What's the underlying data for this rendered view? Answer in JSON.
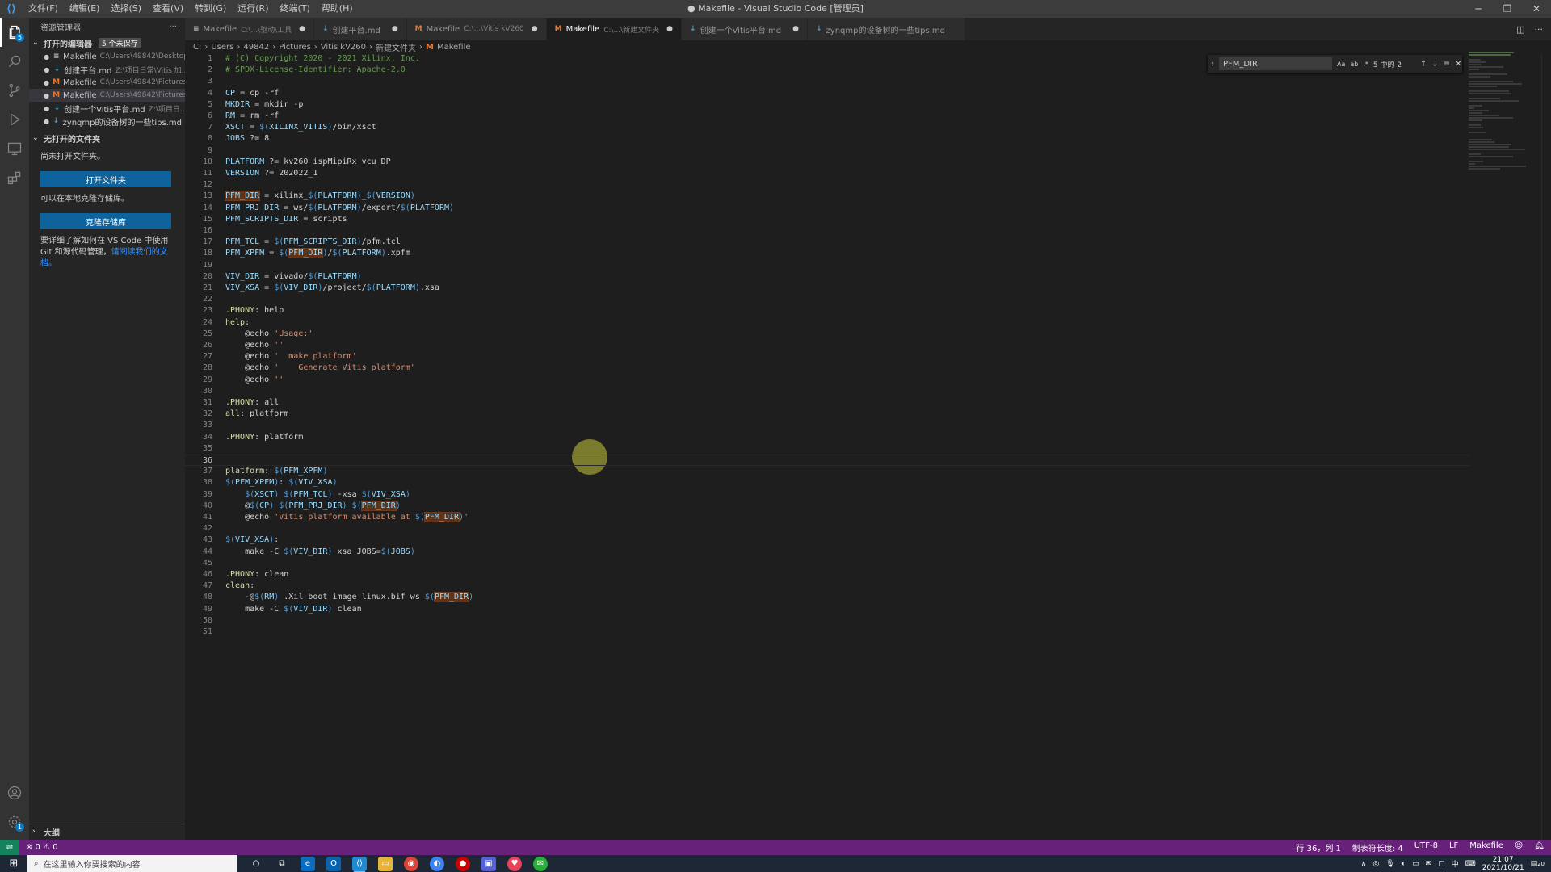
{
  "window": {
    "title": "● Makefile - Visual Studio Code [管理员]",
    "menu": [
      "文件(F)",
      "编辑(E)",
      "选择(S)",
      "查看(V)",
      "转到(G)",
      "运行(R)",
      "终端(T)",
      "帮助(H)"
    ]
  },
  "activity": {
    "icons": [
      "explorer-icon",
      "search-icon",
      "source-control-icon",
      "run-debug-icon",
      "remote-explorer-icon",
      "extensions-icon"
    ],
    "explorer_badge": "5",
    "settings_badge": "1"
  },
  "sidebar": {
    "header": "资源管理器",
    "more": "···",
    "open_editors_label": "打开的编辑器",
    "unsaved_badge": "5 个未保存",
    "open_editors": [
      {
        "icon": "≡",
        "icon_color": "#cccccc",
        "name": "Makefile",
        "path": "C:\\Users\\49842\\Desktop..."
      },
      {
        "icon": "↓",
        "icon_color": "#519aba",
        "name": "创建平台.md",
        "path": "Z:\\项目日常\\Vitis 加..."
      },
      {
        "icon": "M",
        "icon_color": "#e37933",
        "name": "Makefile",
        "path": "C:\\Users\\49842\\Pictures\\..."
      },
      {
        "icon": "M",
        "icon_color": "#e37933",
        "name": "Makefile",
        "path": "C:\\Users\\49842\\Pictures\\..."
      },
      {
        "icon": "↓",
        "icon_color": "#519aba",
        "name": "创建一个Vitis平台.md",
        "path": "Z:\\项目日..."
      },
      {
        "icon": "↓",
        "icon_color": "#519aba",
        "name": "zynqmp的设备树的一些tips.md",
        "path": ""
      }
    ],
    "no_folder_label": "无打开的文件夹",
    "no_folder_text": "尚未打开文件夹。",
    "open_folder_button": "打开文件夹",
    "clone_text": "可以在本地克隆存储库。",
    "clone_button": "克隆存储库",
    "git_text": "要详细了解如何在 VS Code 中使用 Git 和源代码管理，",
    "git_link": "请阅读我们的文档。",
    "outline_label": "大纲"
  },
  "tabs": [
    {
      "icon": "≡",
      "icon_color": "#cccccc",
      "name": "Makefile",
      "path": "C:\\...\\驱动\\工具",
      "dirty": "●",
      "active": false
    },
    {
      "icon": "↓",
      "icon_color": "#519aba",
      "name": "创建平台.md",
      "path": "",
      "dirty": "●",
      "active": false
    },
    {
      "icon": "M",
      "icon_color": "#e37933",
      "name": "Makefile",
      "path": "C:\\...\\Vitis kV260",
      "dirty": "●",
      "active": false
    },
    {
      "icon": "M",
      "icon_color": "#e37933",
      "name": "Makefile",
      "path": "C:\\...\\新建文件夹",
      "dirty": "●",
      "active": true
    },
    {
      "icon": "↓",
      "icon_color": "#519aba",
      "name": "创建一个Vitis平台.md",
      "path": "",
      "dirty": "●",
      "active": false
    },
    {
      "icon": "↓",
      "icon_color": "#519aba",
      "name": "zynqmp的设备树的一些tips.md",
      "path": "",
      "dirty": "",
      "active": false
    }
  ],
  "breadcrumb": [
    "C:",
    "Users",
    "49842",
    "Pictures",
    "Vitis kV260",
    "新建文件夹",
    "Makefile"
  ],
  "find": {
    "value": "PFM_DIR",
    "options": [
      "Aa",
      "ab",
      ".*"
    ],
    "count": "5 中的 2"
  },
  "editor": {
    "current_line": 36,
    "lines": [
      [
        [
          "c-comment",
          "# (C) Copyright 2020 - 2021 Xilinx, Inc."
        ]
      ],
      [
        [
          "c-comment",
          "# SPDX-License-Identifier: Apache-2.0"
        ]
      ],
      [],
      [
        [
          "c-var",
          "CP"
        ],
        [
          "",
          " = cp -rf"
        ]
      ],
      [
        [
          "c-var",
          "MKDIR"
        ],
        [
          "",
          " = mkdir -p"
        ]
      ],
      [
        [
          "c-var",
          "RM"
        ],
        [
          "",
          " = rm -rf"
        ]
      ],
      [
        [
          "c-var",
          "XSCT"
        ],
        [
          "",
          " = "
        ],
        [
          "c-mac",
          "$("
        ],
        [
          "c-var",
          "XILINX_VITIS"
        ],
        [
          "c-mac",
          ")"
        ],
        [
          "",
          "/bin/xsct"
        ]
      ],
      [
        [
          "c-var",
          "JOBS"
        ],
        [
          "",
          " ?= 8"
        ]
      ],
      [],
      [
        [
          "c-var",
          "PLATFORM"
        ],
        [
          "",
          " ?= kv260_ispMipiRx_vcu_DP"
        ]
      ],
      [
        [
          "c-var",
          "VERSION"
        ],
        [
          "",
          " ?= 202022_1"
        ]
      ],
      [],
      [
        [
          "c-var hl",
          "PFM_DIR"
        ],
        [
          "",
          " = xilinx_"
        ],
        [
          "c-mac",
          "$("
        ],
        [
          "c-var",
          "PLATFORM"
        ],
        [
          "c-mac",
          ")"
        ],
        [
          "",
          "_"
        ],
        [
          "c-mac",
          "$("
        ],
        [
          "c-var",
          "VERSION"
        ],
        [
          "c-mac",
          ")"
        ]
      ],
      [
        [
          "c-var",
          "PFM_PRJ_DIR"
        ],
        [
          "",
          " = ws/"
        ],
        [
          "c-mac",
          "$("
        ],
        [
          "c-var",
          "PLATFORM"
        ],
        [
          "c-mac",
          ")"
        ],
        [
          "",
          "/export/"
        ],
        [
          "c-mac",
          "$("
        ],
        [
          "c-var",
          "PLATFORM"
        ],
        [
          "c-mac",
          ")"
        ]
      ],
      [
        [
          "c-var",
          "PFM_SCRIPTS_DIR"
        ],
        [
          "",
          " = scripts"
        ]
      ],
      [],
      [
        [
          "c-var",
          "PFM_TCL"
        ],
        [
          "",
          " = "
        ],
        [
          "c-mac",
          "$("
        ],
        [
          "c-var",
          "PFM_SCRIPTS_DIR"
        ],
        [
          "c-mac",
          ")"
        ],
        [
          "",
          "/pfm.tcl"
        ]
      ],
      [
        [
          "c-var",
          "PFM_XPFM"
        ],
        [
          "",
          " = "
        ],
        [
          "c-mac",
          "$("
        ],
        [
          "c-var hl",
          "PFM_DIR"
        ],
        [
          "c-mac",
          ")"
        ],
        [
          "",
          "/"
        ],
        [
          "c-mac",
          "$("
        ],
        [
          "c-var",
          "PLATFORM"
        ],
        [
          "c-mac",
          ")"
        ],
        [
          "",
          ".xpfm"
        ]
      ],
      [],
      [
        [
          "c-var",
          "VIV_DIR"
        ],
        [
          "",
          " = vivado/"
        ],
        [
          "c-mac",
          "$("
        ],
        [
          "c-var",
          "PLATFORM"
        ],
        [
          "c-mac",
          ")"
        ]
      ],
      [
        [
          "c-var",
          "VIV_XSA"
        ],
        [
          "",
          " = "
        ],
        [
          "c-mac",
          "$("
        ],
        [
          "c-var",
          "VIV_DIR"
        ],
        [
          "c-mac",
          ")"
        ],
        [
          "",
          "/project/"
        ],
        [
          "c-mac",
          "$("
        ],
        [
          "c-var",
          "PLATFORM"
        ],
        [
          "c-mac",
          ")"
        ],
        [
          "",
          ".xsa"
        ]
      ],
      [],
      [
        [
          "c-fn",
          ".PHONY"
        ],
        [
          "",
          ": help"
        ]
      ],
      [
        [
          "c-fn",
          "help"
        ],
        [
          "",
          ":"
        ]
      ],
      [
        [
          "",
          "    @echo "
        ],
        [
          "c-str",
          "'Usage:'"
        ]
      ],
      [
        [
          "",
          "    @echo "
        ],
        [
          "c-str",
          "''"
        ]
      ],
      [
        [
          "",
          "    @echo "
        ],
        [
          "c-str",
          "'  make platform'"
        ]
      ],
      [
        [
          "",
          "    @echo "
        ],
        [
          "c-str",
          "'    Generate Vitis platform'"
        ]
      ],
      [
        [
          "",
          "    @echo "
        ],
        [
          "c-str",
          "''"
        ]
      ],
      [],
      [
        [
          "c-fn",
          ".PHONY"
        ],
        [
          "",
          ": all"
        ]
      ],
      [
        [
          "c-fn",
          "all"
        ],
        [
          "",
          ": platform"
        ]
      ],
      [],
      [
        [
          "c-fn",
          ".PHONY"
        ],
        [
          "",
          ": platform"
        ]
      ],
      [],
      [],
      [
        [
          "c-fn",
          "platform"
        ],
        [
          "",
          ": "
        ],
        [
          "c-mac",
          "$("
        ],
        [
          "c-var",
          "PFM_XPFM"
        ],
        [
          "c-mac",
          ")"
        ]
      ],
      [
        [
          "c-mac",
          "$("
        ],
        [
          "c-var",
          "PFM_XPFM"
        ],
        [
          "c-mac",
          ")"
        ],
        [
          "",
          ": "
        ],
        [
          "c-mac",
          "$("
        ],
        [
          "c-var",
          "VIV_XSA"
        ],
        [
          "c-mac",
          ")"
        ]
      ],
      [
        [
          "",
          "    "
        ],
        [
          "c-mac",
          "$("
        ],
        [
          "c-var",
          "XSCT"
        ],
        [
          "c-mac",
          ")"
        ],
        [
          "",
          " "
        ],
        [
          "c-mac",
          "$("
        ],
        [
          "c-var",
          "PFM_TCL"
        ],
        [
          "c-mac",
          ")"
        ],
        [
          "",
          " -xsa "
        ],
        [
          "c-mac",
          "$("
        ],
        [
          "c-var",
          "VIV_XSA"
        ],
        [
          "c-mac",
          ")"
        ]
      ],
      [
        [
          "",
          "    @"
        ],
        [
          "c-mac",
          "$("
        ],
        [
          "c-var",
          "CP"
        ],
        [
          "c-mac",
          ")"
        ],
        [
          "",
          " "
        ],
        [
          "c-mac",
          "$("
        ],
        [
          "c-var",
          "PFM_PRJ_DIR"
        ],
        [
          "c-mac",
          ")"
        ],
        [
          "",
          " "
        ],
        [
          "c-mac",
          "$("
        ],
        [
          "c-var hl",
          "PFM_DIR"
        ],
        [
          "c-mac",
          ")"
        ]
      ],
      [
        [
          "",
          "    @echo "
        ],
        [
          "c-str",
          "'Vitis platform available at "
        ],
        [
          "c-mac",
          "$("
        ],
        [
          "c-var hl",
          "PFM_DIR"
        ],
        [
          "c-mac",
          ")"
        ],
        [
          "c-str",
          "'"
        ]
      ],
      [],
      [
        [
          "c-mac",
          "$("
        ],
        [
          "c-var",
          "VIV_XSA"
        ],
        [
          "c-mac",
          ")"
        ],
        [
          "",
          ":"
        ]
      ],
      [
        [
          "",
          "    make -C "
        ],
        [
          "c-mac",
          "$("
        ],
        [
          "c-var",
          "VIV_DIR"
        ],
        [
          "c-mac",
          ")"
        ],
        [
          "",
          " xsa JOBS="
        ],
        [
          "c-mac",
          "$("
        ],
        [
          "c-var",
          "JOBS"
        ],
        [
          "c-mac",
          ")"
        ]
      ],
      [],
      [
        [
          "c-fn",
          ".PHONY"
        ],
        [
          "",
          ": clean"
        ]
      ],
      [
        [
          "c-fn",
          "clean"
        ],
        [
          "",
          ":"
        ]
      ],
      [
        [
          "",
          "    -@"
        ],
        [
          "c-mac",
          "$("
        ],
        [
          "c-var",
          "RM"
        ],
        [
          "c-mac",
          ")"
        ],
        [
          "",
          " .Xil boot image linux.bif ws "
        ],
        [
          "c-mac",
          "$("
        ],
        [
          "c-var hl",
          "PFM_DIR"
        ],
        [
          "c-mac",
          ")"
        ]
      ],
      [
        [
          "",
          "    make -C "
        ],
        [
          "c-mac",
          "$("
        ],
        [
          "c-var",
          "VIV_DIR"
        ],
        [
          "c-mac",
          ")"
        ],
        [
          "",
          " clean"
        ]
      ],
      [],
      []
    ]
  },
  "status": {
    "errors": "⊗ 0 ⚠ 0",
    "position": "行 36，列 1",
    "indent": "制表符长度: 4",
    "encoding": "UTF-8",
    "eol": "LF",
    "language": "Makefile"
  },
  "taskbar": {
    "search_placeholder": "在这里输入你要搜索的内容",
    "time": "21:07",
    "date": "2021/10/21",
    "notify_count": "20",
    "ime": "中"
  }
}
